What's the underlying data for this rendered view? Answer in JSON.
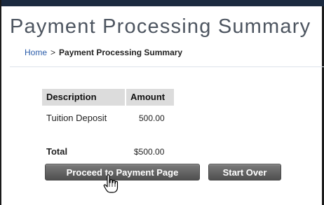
{
  "header": {
    "title": "Payment Processing Summary"
  },
  "breadcrumb": {
    "home": "Home",
    "separator": ">",
    "current": "Payment Processing Summary"
  },
  "table": {
    "columns": [
      "Description",
      "Amount"
    ],
    "rows": [
      {
        "description": "Tuition Deposit",
        "amount": "500.00"
      }
    ],
    "total_label": "Total",
    "total_amount": "$500.00"
  },
  "buttons": {
    "proceed": "Proceed to Payment Page",
    "start_over": "Start Over"
  },
  "icons": {
    "cursor": "hand-pointer-icon"
  },
  "colors": {
    "title": "#4d5560",
    "link": "#2a5caa",
    "header_bg": "#dcdcdc",
    "button": "#5f5f5f"
  }
}
